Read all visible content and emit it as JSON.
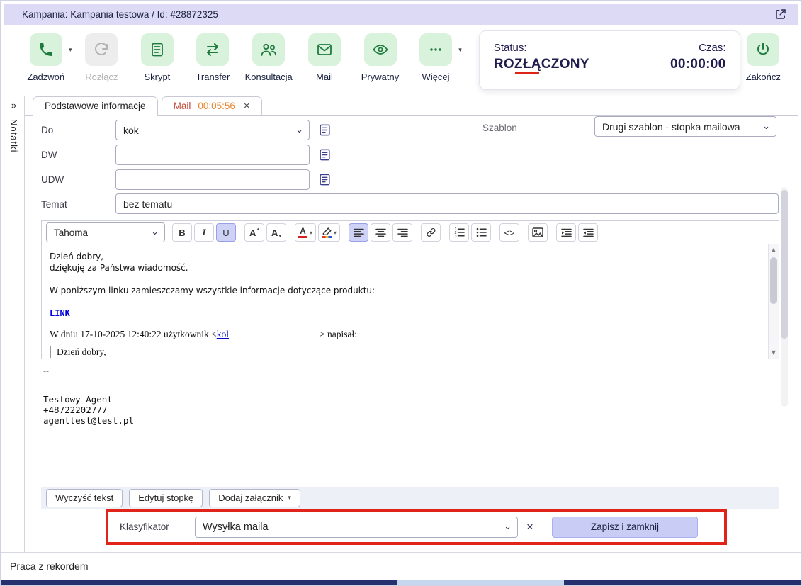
{
  "titlebar": {
    "title": "Kampania: Kampania testowa / Id: #28872325"
  },
  "toolbar": {
    "call": "Zadzwoń",
    "hangup": "Rozłącz",
    "script": "Skrypt",
    "transfer": "Transfer",
    "consult": "Konsultacja",
    "mail": "Mail",
    "private": "Prywatny",
    "more": "Więcej",
    "end": "Zakończ"
  },
  "status_panel": {
    "status_label": "Status:",
    "status_value": "ROZŁĄCZONY",
    "time_label": "Czas:",
    "time_value": "00:00:00"
  },
  "notes_strip": {
    "label": "Notatki"
  },
  "tabs": {
    "basic_label": "Podstawowe informacje",
    "mail_label": "Mail",
    "mail_timer": "00:05:56"
  },
  "form": {
    "to_label": "Do",
    "to_value": "kok",
    "dw_label": "DW",
    "udw_label": "UDW",
    "subject_label": "Temat",
    "subject_value": "bez tematu",
    "template_label": "Szablon",
    "template_value": "Drugi szablon - stopka mailowa"
  },
  "editor_toolbar": {
    "font_name": "Tahoma",
    "bold_glyph": "B",
    "italic_glyph": "I",
    "underline_glyph": "U",
    "font_up_glyph": "A",
    "font_down_glyph": "A",
    "text_color_glyph": "A",
    "code_glyph": "<>"
  },
  "editor": {
    "line1": "Dzień dobry,",
    "line2": "dziękuję za Państwa wiadomość.",
    "line3": "W poniższym linku zamieszczamy wszystkie informacje dotyczące produktu:",
    "link_text": "LINK",
    "quote_prefix": "W dniu 17-10-2025 12:40:22 użytkownik <",
    "quote_link": "kol",
    "quote_suffix": "> napisał:",
    "quote_body": "Dzień dobry,",
    "sig_separator": "--",
    "sig_name": "Testowy Agent",
    "sig_phone": "+48722202777",
    "sig_email": "agenttest@test.pl"
  },
  "actions": {
    "clear_text": "Wyczyść tekst",
    "edit_footer": "Edytuj stopkę",
    "add_attachment": "Dodaj załącznik"
  },
  "classifier": {
    "label": "Klasyfikator",
    "value": "Wysyłka maila",
    "save_label": "Zapisz i zamknij"
  },
  "footer": {
    "status": "Praca z rekordem"
  },
  "icons": {
    "caret_down": "▾",
    "caret_up_small": "▴",
    "caret_down_small": "▾",
    "select_chevron": "⌄",
    "scroll_up": "▲",
    "scroll_down": "▼",
    "expand_chevrons": "»",
    "close": "×"
  },
  "colors": {
    "icon_bg_green": "#d9f2dc",
    "icon_green": "#1f7a3f",
    "titlebar_lavender": "#dcdaf5",
    "navy": "#201c4e",
    "alert_red_border": "#e0241a",
    "save_button_lavender": "#c9ccf5",
    "mail_tab_red": "#c24a3a",
    "timer_orange": "#e8842c",
    "link_blue": "#0000e0"
  }
}
